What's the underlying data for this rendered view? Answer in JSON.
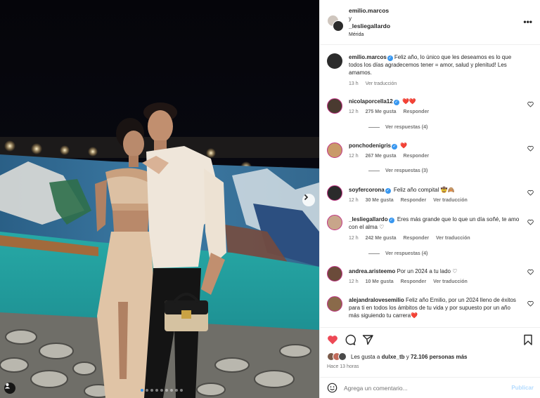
{
  "post": {
    "author": "emilio.marcos",
    "connector": "y",
    "coauthor": "_lesliegallardo",
    "location": "Mérida",
    "caption_author": "emilio.marcos",
    "caption_text": "Feliz año, lo único que les deseamos es lo que todos los días agradecemos tener = amor, salud y plenitud! Les amamos.",
    "caption_time": "13 h",
    "caption_translate": "Ver traducción"
  },
  "comments": [
    {
      "user": "nicolaporcella12",
      "verified": true,
      "text": "❤️❤️",
      "time": "12 h",
      "likes": "275 Me gusta",
      "reply": "Responder",
      "translate": "",
      "replies": "Ver respuestas (4)",
      "avatar_color": "#4a3a30"
    },
    {
      "user": "ponchodenigris",
      "verified": true,
      "text": "❤️",
      "time": "12 h",
      "likes": "267 Me gusta",
      "reply": "Responder",
      "translate": "",
      "replies": "Ver respuestas (3)",
      "avatar_color": "#c99a6a"
    },
    {
      "user": "soyfercorona",
      "verified": true,
      "text": "Feliz año compital 🤠🙈",
      "time": "12 h",
      "likes": "30 Me gusta",
      "reply": "Responder",
      "translate": "Ver traducción",
      "replies": "",
      "avatar_color": "#2b2b2b"
    },
    {
      "user": "_lesliegallardo",
      "verified": true,
      "text": "Eres más grande que lo que un día soñé, te amo con el alma ♡",
      "time": "12 h",
      "likes": "242 Me gusta",
      "reply": "Responder",
      "translate": "Ver traducción",
      "replies": "Ver respuestas (4)",
      "avatar_color": "#c8a58a"
    },
    {
      "user": "andrea.aristeemo",
      "verified": false,
      "text": "Por un 2024 a tu lado ♡",
      "time": "12 h",
      "likes": "10 Me gusta",
      "reply": "Responder",
      "translate": "Ver traducción",
      "replies": "",
      "avatar_color": "#6b4b3a"
    },
    {
      "user": "alejandralovesemilio",
      "verified": false,
      "text": "Feliz año Emilio, por un 2024 lleno de éxitos para ti en todos los ámbitos de tu vida y por supuesto por un año más siguiendo tu carrera❤️",
      "time": "",
      "likes": "",
      "reply": "",
      "translate": "",
      "replies": "",
      "avatar_color": "#8a6a4a"
    }
  ],
  "likes": {
    "prefix": "Les gusta a",
    "user": "dulxe_tb",
    "middle": "y",
    "count": "72.106 personas más"
  },
  "time_ago": "Hace 13 horas",
  "composer": {
    "placeholder": "Agrega un comentario...",
    "publish": "Publicar"
  },
  "colors": {
    "like_red": "#ed4956",
    "verified_blue": "#3897f0",
    "publish_blue": "#b3dbff"
  },
  "icons": [
    "heart-icon",
    "comment-icon",
    "share-icon",
    "bookmark-icon",
    "emoji-icon",
    "more-icon",
    "next-arrow-icon",
    "user-tag-icon"
  ]
}
